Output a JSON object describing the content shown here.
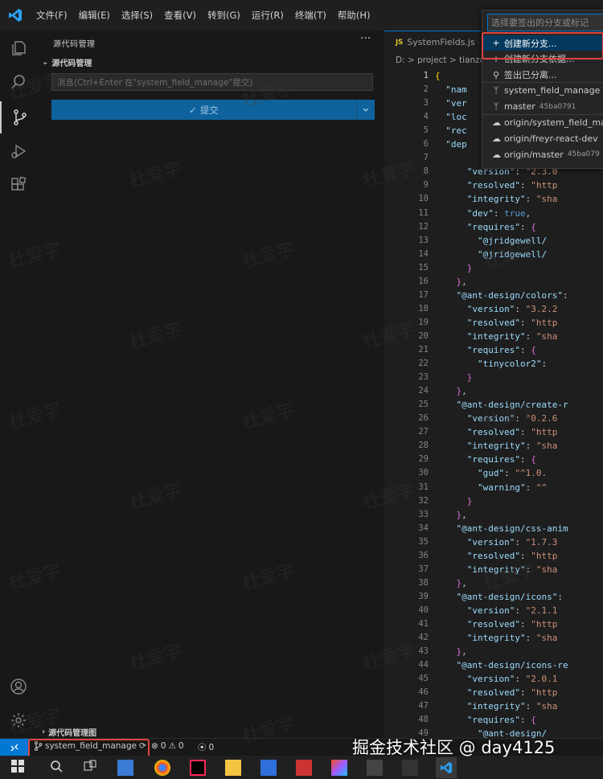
{
  "menu": [
    "文件(F)",
    "编辑(E)",
    "选择(S)",
    "查看(V)",
    "转到(G)",
    "运行(R)",
    "终端(T)",
    "帮助(H)"
  ],
  "sidebar": {
    "header": "源代码管理",
    "more": "···",
    "section": "源代码管理",
    "message_placeholder": "消息(Ctrl+Enter 在\"system_field_manage\"提交)",
    "commit_label": "提交",
    "footer_section": "源代码管理图"
  },
  "editor": {
    "tab_name": "SystemFields.js",
    "tab_badge": "JS",
    "breadcrumb": "D: > project > tianzu",
    "lines": [
      {
        "n": "1",
        "t": "{"
      },
      {
        "n": "2",
        "t": "  \"nam"
      },
      {
        "n": "3",
        "t": "  \"ver"
      },
      {
        "n": "4",
        "t": "  \"loc"
      },
      {
        "n": "5",
        "t": "  \"rec"
      },
      {
        "n": "6",
        "t": "  \"dep"
      },
      {
        "n": "7",
        "t": ""
      },
      {
        "n": "8",
        "t": "      \"version\": \"2.3.0"
      },
      {
        "n": "9",
        "t": "      \"resolved\": \"http"
      },
      {
        "n": "10",
        "t": "      \"integrity\": \"sha"
      },
      {
        "n": "11",
        "t": "      \"dev\": true,"
      },
      {
        "n": "12",
        "t": "      \"requires\": {"
      },
      {
        "n": "13",
        "t": "        \"@jridgewell/"
      },
      {
        "n": "14",
        "t": "        \"@jridgewell/"
      },
      {
        "n": "15",
        "t": "      }"
      },
      {
        "n": "16",
        "t": "    },"
      },
      {
        "n": "17",
        "t": "    \"@ant-design/colors\":"
      },
      {
        "n": "18",
        "t": "      \"version\": \"3.2.2"
      },
      {
        "n": "19",
        "t": "      \"resolved\": \"http"
      },
      {
        "n": "20",
        "t": "      \"integrity\": \"sha"
      },
      {
        "n": "21",
        "t": "      \"requires\": {"
      },
      {
        "n": "22",
        "t": "        \"tinycolor2\":"
      },
      {
        "n": "23",
        "t": "      }"
      },
      {
        "n": "24",
        "t": "    },"
      },
      {
        "n": "25",
        "t": "    \"@ant-design/create-r"
      },
      {
        "n": "26",
        "t": "      \"version\": \"0.2.6"
      },
      {
        "n": "27",
        "t": "      \"resolved\": \"http"
      },
      {
        "n": "28",
        "t": "      \"integrity\": \"sha"
      },
      {
        "n": "29",
        "t": "      \"requires\": {"
      },
      {
        "n": "30",
        "t": "        \"gud\": \"^1.0."
      },
      {
        "n": "31",
        "t": "        \"warning\": \"^"
      },
      {
        "n": "32",
        "t": "      }"
      },
      {
        "n": "33",
        "t": "    },"
      },
      {
        "n": "34",
        "t": "    \"@ant-design/css-anim"
      },
      {
        "n": "35",
        "t": "      \"version\": \"1.7.3"
      },
      {
        "n": "36",
        "t": "      \"resolved\": \"http"
      },
      {
        "n": "37",
        "t": "      \"integrity\": \"sha"
      },
      {
        "n": "38",
        "t": "    },"
      },
      {
        "n": "39",
        "t": "    \"@ant-design/icons\":"
      },
      {
        "n": "40",
        "t": "      \"version\": \"2.1.1"
      },
      {
        "n": "41",
        "t": "      \"resolved\": \"http"
      },
      {
        "n": "42",
        "t": "      \"integrity\": \"sha"
      },
      {
        "n": "43",
        "t": "    },"
      },
      {
        "n": "44",
        "t": "    \"@ant-design/icons-re"
      },
      {
        "n": "45",
        "t": "      \"version\": \"2.0.1"
      },
      {
        "n": "46",
        "t": "      \"resolved\": \"http"
      },
      {
        "n": "47",
        "t": "      \"integrity\": \"sha"
      },
      {
        "n": "48",
        "t": "      \"requires\": {"
      },
      {
        "n": "49",
        "t": "        \"@ant-design/"
      }
    ]
  },
  "quickpick": {
    "placeholder": "选择要签出的分支或标记",
    "items": [
      {
        "icon": "plus-icon",
        "label": "创建新分支...",
        "hash": "",
        "selected": true
      },
      {
        "icon": "plus-icon",
        "label": "创建新分支依据...",
        "hash": "",
        "selected": false
      },
      {
        "icon": "detach-icon",
        "label": "签出已分离...",
        "hash": "",
        "selected": false
      },
      {
        "icon": "branch-icon",
        "label": "system_field_manage",
        "hash": "",
        "selected": false
      },
      {
        "icon": "branch-icon",
        "label": "master",
        "hash": "45ba0791",
        "selected": false
      },
      {
        "icon": "cloud-icon",
        "label": "origin/system_field_ma",
        "hash": "",
        "selected": false
      },
      {
        "icon": "cloud-icon",
        "label": "origin/freyr-react-dev",
        "hash": "",
        "selected": false
      },
      {
        "icon": "cloud-icon",
        "label": "origin/master",
        "hash": "45ba079",
        "selected": false
      }
    ]
  },
  "status": {
    "branch": "system_field_manage",
    "errors": "0",
    "warnings": "0",
    "ports": "0"
  },
  "watermark": {
    "repeat": "杜爱宇",
    "bottom": "掘金技术社区 @ day4125"
  },
  "colors": {
    "accent": "#0078d4",
    "highlight": "#e0443e",
    "commit_button": "#0e639c"
  }
}
